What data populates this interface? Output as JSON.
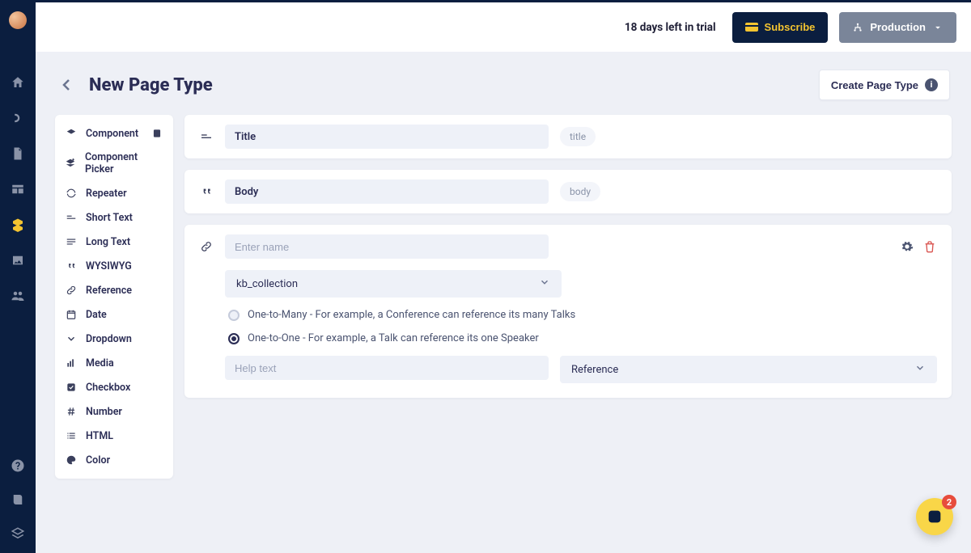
{
  "header": {
    "trial_text": "18 days left in trial",
    "subscribe_label": "Subscribe",
    "env_label": "Production"
  },
  "page": {
    "title": "New Page Type",
    "create_label": "Create Page Type"
  },
  "field_types": [
    "Component",
    "Component Picker",
    "Repeater",
    "Short Text",
    "Long Text",
    "WYSIWYG",
    "Reference",
    "Date",
    "Dropdown",
    "Media",
    "Checkbox",
    "Number",
    "HTML",
    "Color"
  ],
  "fields": {
    "title": {
      "label": "Title",
      "slug": "title"
    },
    "body": {
      "label": "Body",
      "slug": "body"
    }
  },
  "reference_editor": {
    "name_placeholder": "Enter name",
    "collection_selected": "kb_collection",
    "relation_one_to_many": "One-to-Many - For example, a Conference can reference its many Talks",
    "relation_one_to_one": "One-to-One - For example, a Talk can reference its one Speaker",
    "relation_selected": "one_to_one",
    "help_placeholder": "Help text",
    "display_selected": "Reference"
  },
  "chat_badge": "2"
}
